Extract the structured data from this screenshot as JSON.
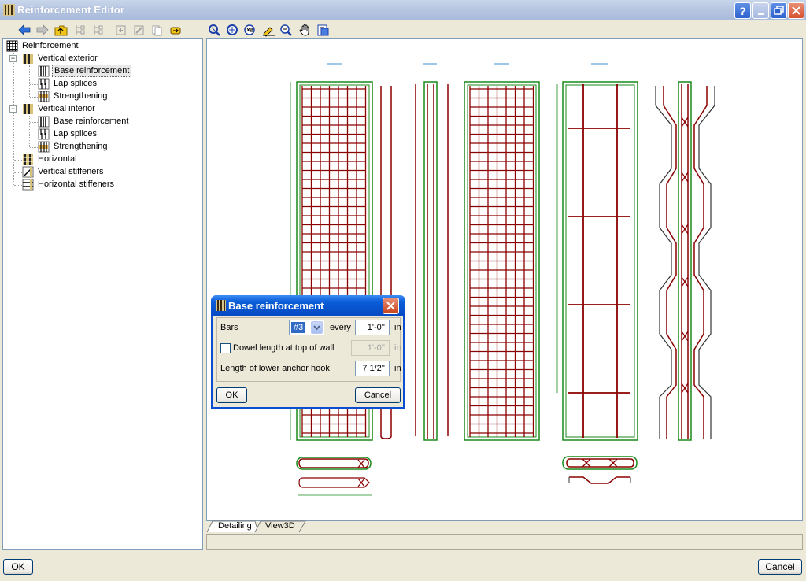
{
  "window": {
    "title": "Reinforcement Editor"
  },
  "left_toolbar": {
    "icons": [
      "back-arrow-icon",
      "forward-arrow-icon",
      "folder-up-icon",
      "tree-add-icon",
      "tree-remove-icon",
      "new-item-icon",
      "edit-icon",
      "copy-icon",
      "export-icon"
    ]
  },
  "tree": {
    "root": "Reinforcement",
    "items": [
      {
        "label": "Vertical exterior"
      },
      {
        "label": "Base reinforcement"
      },
      {
        "label": "Lap splices"
      },
      {
        "label": "Strengthening"
      },
      {
        "label": "Vertical interior"
      },
      {
        "label": "Base reinforcement"
      },
      {
        "label": "Lap splices"
      },
      {
        "label": "Strengthening"
      },
      {
        "label": "Horizontal"
      },
      {
        "label": "Vertical stiffeners"
      },
      {
        "label": "Horizontal stiffeners"
      }
    ],
    "selected": "Vertical exterior / Base reinforcement"
  },
  "view_toolbar": {
    "icons": [
      "zoom-window-icon",
      "zoom-all-icon",
      "zoom-x2-icon",
      "zoom-half-icon",
      "zoom-icon",
      "pan-hand-icon",
      "view-options-icon"
    ]
  },
  "tabs": [
    {
      "label": "Detailing",
      "active": true
    },
    {
      "label": "View3D",
      "active": false
    }
  ],
  "footer": {
    "ok_label": "OK",
    "cancel_label": "Cancel"
  },
  "dialog": {
    "title": "Base reinforcement",
    "bars_label": "Bars",
    "bars_value": "#3",
    "every_label": "every",
    "every_value": "1'-0''",
    "unit": "in",
    "dowel_label": "Dowel length at top of wall",
    "dowel_value": "1'-0''",
    "dowel_checked": false,
    "hook_label": "Length of lower anchor hook",
    "hook_value": "7 1/2''",
    "ok_label": "OK",
    "cancel_label": "Cancel"
  },
  "colors": {
    "rebar": "#8b0000",
    "concrete_outline": "#1a8a1a",
    "xp_blue": "#0a5ed8"
  }
}
